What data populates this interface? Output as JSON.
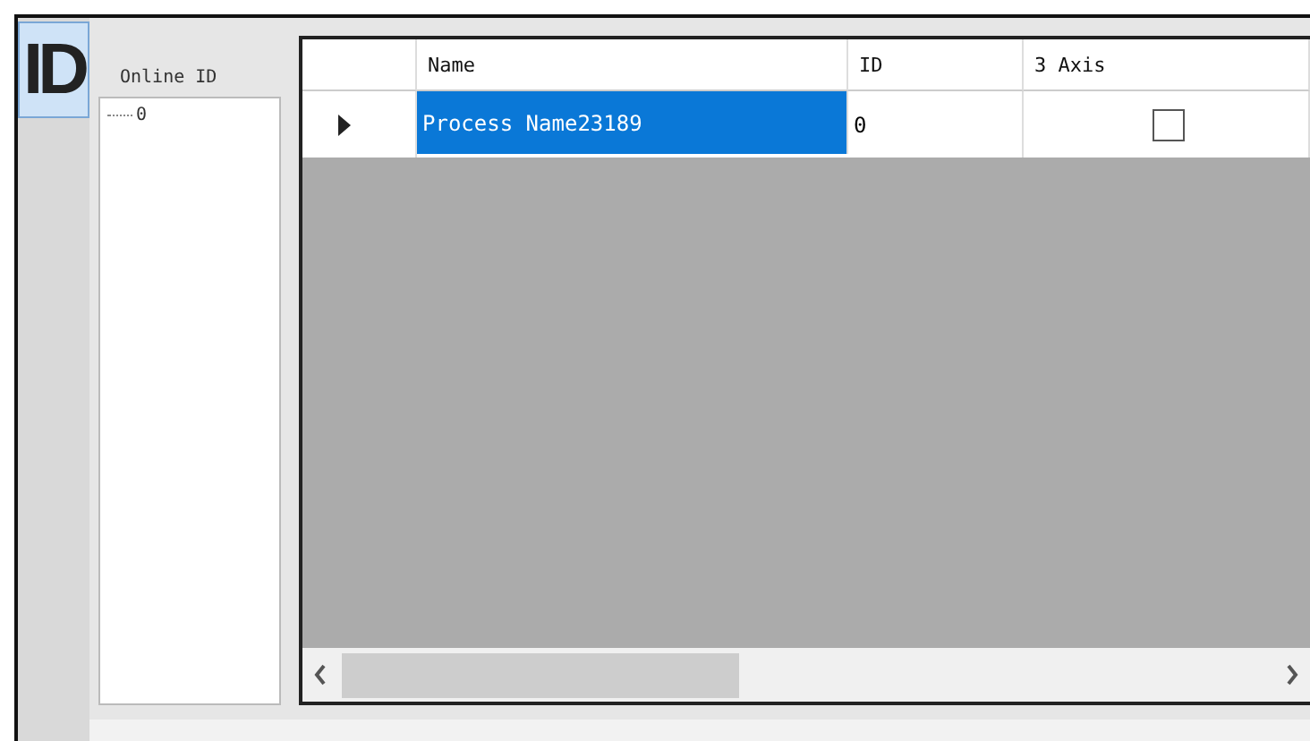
{
  "side_tab": {
    "label": "ID",
    "selected": true
  },
  "tree": {
    "title": "Online ID",
    "items": [
      {
        "label": "0",
        "selected": false
      }
    ]
  },
  "grid": {
    "columns": [
      "Name",
      "ID",
      "3 Axis"
    ],
    "rows": [
      {
        "current": true,
        "name": "Process Name23189",
        "name_selected": true,
        "id": "0",
        "three_axis": false
      }
    ]
  }
}
